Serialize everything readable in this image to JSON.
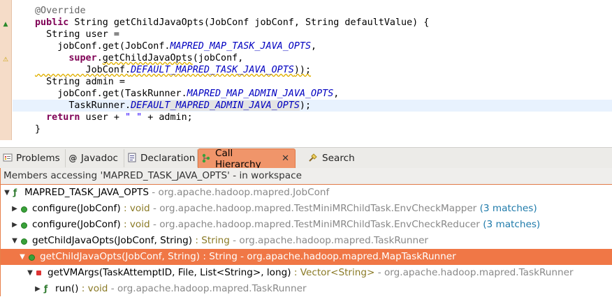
{
  "editor": {
    "lines": [
      "@Override",
      "public String getChildJavaOpts(JobConf jobConf, String defaultValue) {",
      "String user =",
      "jobConf.get(JobConf.MAPRED_MAP_TASK_JAVA_OPTS,",
      "super.getChildJavaOpts(jobConf,",
      "JobConf.DEFAULT_MAPRED_TASK_JAVA_OPTS));",
      "String admin =",
      "jobConf.get(TaskRunner.MAPRED_MAP_ADMIN_JAVA_OPTS,",
      "TaskRunner.DEFAULT_MAPRED_ADMIN_JAVA_OPTS);",
      "return user + \" \" + admin;",
      "}"
    ]
  },
  "tabs": [
    {
      "label": "Problems",
      "icon": "problems-icon"
    },
    {
      "label": "Javadoc",
      "icon": "javadoc-icon"
    },
    {
      "label": "Declaration",
      "icon": "declaration-icon"
    },
    {
      "label": "Call Hierarchy",
      "icon": "call-hierarchy-icon",
      "active": true
    },
    {
      "label": "Search",
      "icon": "search-icon"
    }
  ],
  "view": {
    "status": "Members accessing 'MAPRED_TASK_JAVA_OPTS' - in workspace",
    "tree": [
      {
        "depth": 0,
        "twisty": "open",
        "icon": "field",
        "name": "MAPRED_TASK_JAVA_OPTS",
        "ret": "",
        "pkg": " - org.apache.hadoop.mapred.JobConf",
        "matches": ""
      },
      {
        "depth": 1,
        "twisty": "closed",
        "icon": "pub",
        "name": "configure(JobConf)",
        "ret": " : void",
        "pkg": " - org.apache.hadoop.mapred.TestMiniMRChildTask.EnvCheckMapper",
        "matches": " (3 matches)"
      },
      {
        "depth": 1,
        "twisty": "closed",
        "icon": "pub",
        "name": "configure(JobConf)",
        "ret": " : void",
        "pkg": " - org.apache.hadoop.mapred.TestMiniMRChildTask.EnvCheckReducer",
        "matches": " (3 matches)"
      },
      {
        "depth": 1,
        "twisty": "open",
        "icon": "pub-ov",
        "name": "getChildJavaOpts(JobConf, String)",
        "ret": " : String",
        "pkg": " - org.apache.hadoop.mapred.TaskRunner",
        "matches": ""
      },
      {
        "depth": 2,
        "twisty": "open",
        "icon": "pub-ov",
        "name": "getChildJavaOpts(JobConf, String)",
        "ret": " : String",
        "pkg": " - org.apache.hadoop.mapred.MapTaskRunner",
        "matches": "",
        "selected": true
      },
      {
        "depth": 3,
        "twisty": "open",
        "icon": "prot",
        "name": "getVMArgs(TaskAttemptID, File, List<String>, long)",
        "ret": " : Vector<String>",
        "pkg": " - org.apache.hadoop.mapred.TaskRunner",
        "matches": ""
      },
      {
        "depth": 4,
        "twisty": "closed",
        "icon": "pub-f",
        "name": "run()",
        "ret": " : void",
        "pkg": " - org.apache.hadoop.mapred.TaskRunner",
        "matches": ""
      }
    ]
  }
}
